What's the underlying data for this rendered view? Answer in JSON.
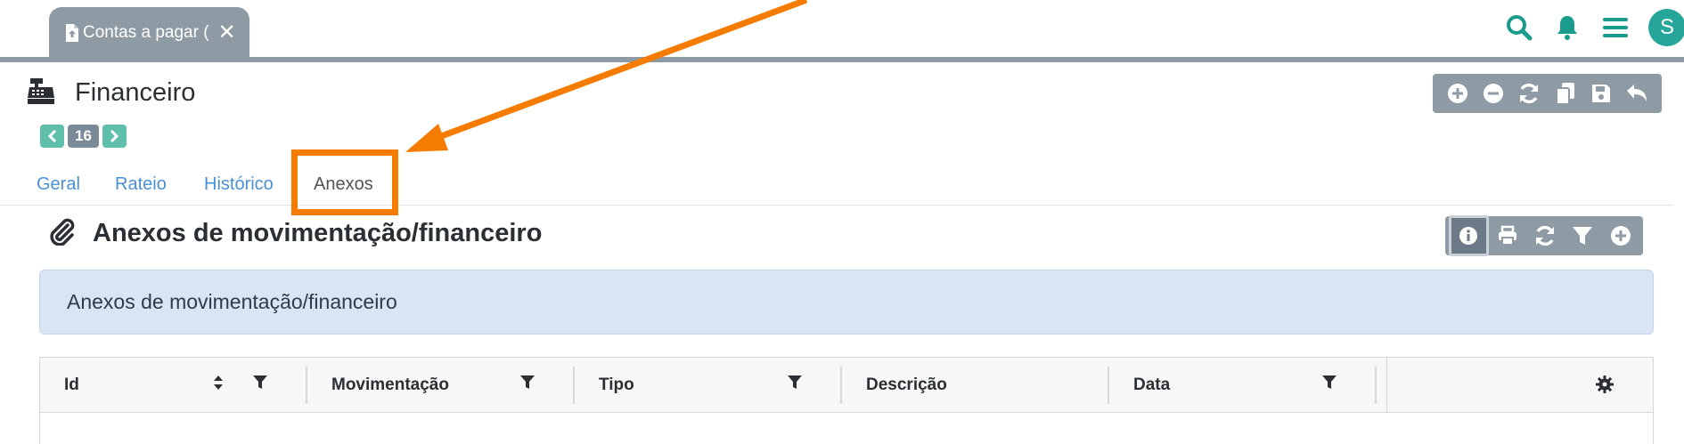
{
  "window_tab": {
    "label": "Contas a pagar (",
    "icon": "file-upload-icon"
  },
  "top_icons": [
    "search-icon",
    "bell-icon",
    "hamburger-menu-icon"
  ],
  "avatar_initial": "S",
  "page": {
    "title": "Financeiro",
    "icon": "cash-register-icon"
  },
  "pager": {
    "current": "16"
  },
  "main_toolbar": [
    "plus-circle-icon",
    "minus-circle-icon",
    "refresh-icon",
    "copy-icon",
    "save-icon",
    "undo-icon"
  ],
  "tabs": [
    {
      "label": "Geral"
    },
    {
      "label": "Rateio"
    },
    {
      "label": "Histórico"
    },
    {
      "label": "Anexos"
    }
  ],
  "section": {
    "title": "Anexos de movimentação/financeiro",
    "icon": "paperclip-icon"
  },
  "section_toolbar": [
    "info-icon",
    "print-icon",
    "refresh-icon",
    "filter-icon",
    "plus-circle-icon"
  ],
  "info_text": "Anexos de movimentação/financeiro",
  "table": {
    "columns": [
      {
        "label": "Id"
      },
      {
        "label": "Movimentação"
      },
      {
        "label": "Tipo"
      },
      {
        "label": "Descrição"
      },
      {
        "label": "Data"
      }
    ]
  },
  "colors": {
    "accent": "#1a9c8c",
    "toolbar_gray": "#8e9ba5",
    "link_blue": "#4a90d9",
    "highlight_orange": "#f57c00",
    "info_bg": "#d9e4f4"
  }
}
